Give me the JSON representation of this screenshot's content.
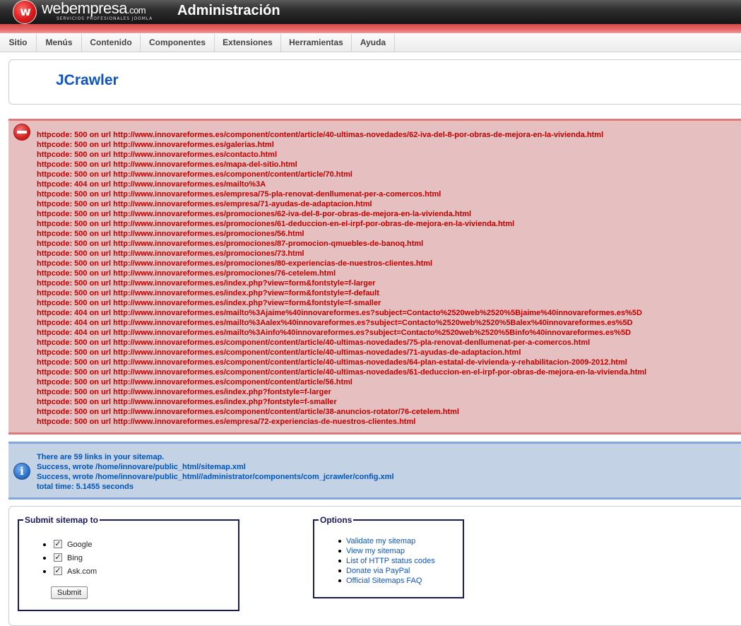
{
  "header": {
    "logo_mark": "w",
    "logo_name": "webempresa",
    "logo_suffix": ".com",
    "logo_tagline": "SERVICIOS PROFESIONALES JOOMLA",
    "title": "Administración"
  },
  "menu": [
    "Sitio",
    "Menús",
    "Contenido",
    "Componentes",
    "Extensiones",
    "Herramientas",
    "Ayuda"
  ],
  "component_title": "JCrawler",
  "errors": [
    "httpcode: 500 on url http://www.innovareformes.es/component/content/article/40-ultimas-novedades/62-iva-del-8-por-obras-de-mejora-en-la-vivienda.html",
    "httpcode: 500 on url http://www.innovareformes.es/galerias.html",
    "httpcode: 500 on url http://www.innovareformes.es/contacto.html",
    "httpcode: 500 on url http://www.innovareformes.es/mapa-del-sitio.html",
    "httpcode: 500 on url http://www.innovareformes.es/component/content/article/70.html",
    "httpcode: 404 on url http://www.innovareformes.es/mailto%3A",
    "httpcode: 500 on url http://www.innovareformes.es/empresa/75-pla-renovat-denllumenat-per-a-comercos.html",
    "httpcode: 500 on url http://www.innovareformes.es/empresa/71-ayudas-de-adaptacion.html",
    "httpcode: 500 on url http://www.innovareformes.es/promociones/62-iva-del-8-por-obras-de-mejora-en-la-vivienda.html",
    "httpcode: 500 on url http://www.innovareformes.es/promociones/61-deduccion-en-el-irpf-por-obras-de-mejora-en-la-vivienda.html",
    "httpcode: 500 on url http://www.innovareformes.es/promociones/56.html",
    "httpcode: 500 on url http://www.innovareformes.es/promociones/87-promocion-qmuebles-de-banoq.html",
    "httpcode: 500 on url http://www.innovareformes.es/promociones/73.html",
    "httpcode: 500 on url http://www.innovareformes.es/promociones/80-experiencias-de-nuestros-clientes.html",
    "httpcode: 500 on url http://www.innovareformes.es/promociones/76-cetelem.html",
    "httpcode: 500 on url http://www.innovareformes.es/index.php?view=form&fontstyle=f-larger",
    "httpcode: 500 on url http://www.innovareformes.es/index.php?view=form&fontstyle=f-default",
    "httpcode: 500 on url http://www.innovareformes.es/index.php?view=form&fontstyle=f-smaller",
    "httpcode: 404 on url http://www.innovareformes.es/mailto%3Ajaime%40innovareformes.es?subject=Contacto%2520web%2520%5Bjaime%40innovareformes.es%5D",
    "httpcode: 404 on url http://www.innovareformes.es/mailto%3Aalex%40innovareformes.es?subject=Contacto%2520web%2520%5Balex%40innovareformes.es%5D",
    "httpcode: 404 on url http://www.innovareformes.es/mailto%3Ainfo%40innovareformes.es?subject=Contacto%2520web%2520%5Binfo%40innovareformes.es%5D",
    "httpcode: 500 on url http://www.innovareformes.es/component/content/article/40-ultimas-novedades/75-pla-renovat-denllumenat-per-a-comercos.html",
    "httpcode: 500 on url http://www.innovareformes.es/component/content/article/40-ultimas-novedades/71-ayudas-de-adaptacion.html",
    "httpcode: 500 on url http://www.innovareformes.es/component/content/article/40-ultimas-novedades/64-plan-estatal-de-vivienda-y-rehabilitacion-2009-2012.html",
    "httpcode: 500 on url http://www.innovareformes.es/component/content/article/40-ultimas-novedades/61-deduccion-en-el-irpf-por-obras-de-mejora-en-la-vivienda.html",
    "httpcode: 500 on url http://www.innovareformes.es/component/content/article/56.html",
    "httpcode: 500 on url http://www.innovareformes.es/index.php?fontstyle=f-larger",
    "httpcode: 500 on url http://www.innovareformes.es/index.php?fontstyle=f-smaller",
    "httpcode: 500 on url http://www.innovareformes.es/component/content/article/38-anuncios-rotator/76-cetelem.html",
    "httpcode: 500 on url http://www.innovareformes.es/empresa/72-experiencias-de-nuestros-clientes.html"
  ],
  "info": [
    "There are 59 links in your sitemap.",
    "Success, wrote /home/innovare/public_html/sitemap.xml",
    "Success, wrote /home/innovare/public_html//administrator/components/com_jcrawler/config.xml",
    "total time: 5.1455 seconds"
  ],
  "submit_panel": {
    "legend": "Submit sitemap to",
    "engines": [
      {
        "label": "Google",
        "checked": true
      },
      {
        "label": "Bing",
        "checked": true
      },
      {
        "label": "Ask.com",
        "checked": true
      }
    ],
    "check_mark": "✓",
    "button": "Submit"
  },
  "options_panel": {
    "legend": "Options",
    "links": [
      "Validate my sitemap",
      "View my sitemap",
      "List of HTTP status codes",
      "Donate via PayPal",
      "Official Sitemaps FAQ"
    ]
  },
  "icons": {
    "error": "error-stop-icon",
    "info": "info-icon"
  },
  "colors": {
    "error_text": "#c00000",
    "info_text": "#0055bb",
    "title": "#0b55c4",
    "header_band": "#e86868"
  }
}
